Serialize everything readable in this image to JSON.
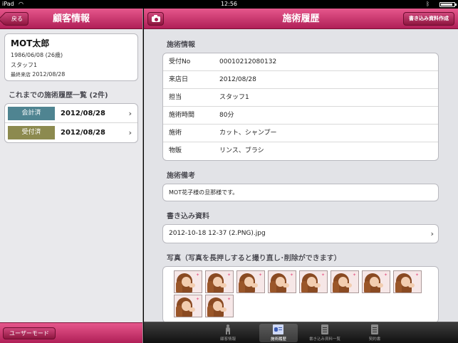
{
  "status_bar": {
    "carrier": "iPad",
    "time": "12:56",
    "battery_level": 0.9
  },
  "left_pane": {
    "title": "顧客情報",
    "back_label": "戻る",
    "customer": {
      "name": "MOT太郎",
      "birth": "1986/06/08 (26歳)",
      "staff": "スタッフ1",
      "last_visit_label": "最終来店",
      "last_visit_date": "2012/08/28"
    },
    "history_header": "これまでの施術履歴一覧 (2件)",
    "history": [
      {
        "status": "会計済",
        "date": "2012/08/28",
        "color": "#4f8491"
      },
      {
        "status": "受付済",
        "date": "2012/08/28",
        "color": "#8c8a4f"
      }
    ],
    "user_mode_label": "ユーザーモード"
  },
  "right_pane": {
    "title": "施術履歴",
    "create_button": "書き込み資料作成",
    "info_header": "施術情報",
    "info_rows": [
      {
        "label": "受付No",
        "value": "00010212080132"
      },
      {
        "label": "来店日",
        "value": "2012/08/28"
      },
      {
        "label": "担当",
        "value": "スタッフ1"
      },
      {
        "label": "施術時間",
        "value": "80分"
      },
      {
        "label": "施術",
        "value": "カット、シャンプー"
      },
      {
        "label": "物販",
        "value": "リンス、ブラシ"
      }
    ],
    "notes_header": "施術備考",
    "notes": "MOT花子様の旦那様です。",
    "files_header": "書き込み資料",
    "file_name": "2012-10-18 12-37 (2.PNG).jpg",
    "photos_header": "写真（写真を長押しすると撮り直し･削除ができます）",
    "photo_count": 10
  },
  "tabbar": {
    "tabs": [
      {
        "label": "顧客情報",
        "icon": "person-icon",
        "active": false
      },
      {
        "label": "施術履歴",
        "icon": "id-card-icon",
        "active": true
      },
      {
        "label": "書き込み資料一覧",
        "icon": "document-icon",
        "active": false
      },
      {
        "label": "契約書",
        "icon": "document-icon",
        "active": false
      }
    ]
  },
  "colors": {
    "accent_pink": "#c8336b",
    "status_paid": "#4f8491",
    "status_received": "#8c8a4f"
  }
}
